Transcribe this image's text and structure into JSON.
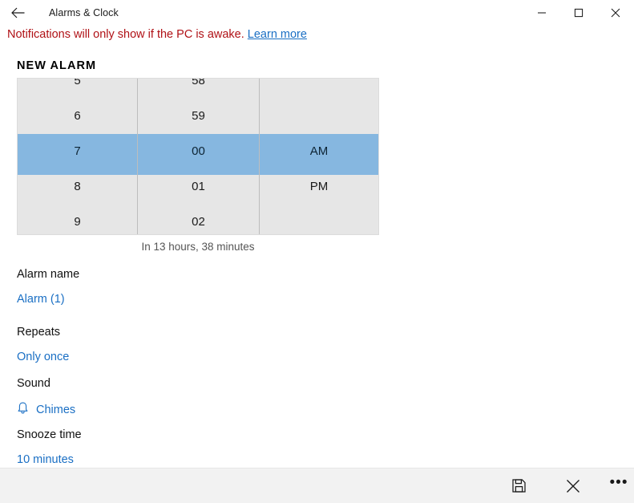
{
  "window": {
    "title": "Alarms & Clock",
    "back_icon": "back-arrow-icon",
    "minimize_label": "Minimize",
    "maximize_label": "Maximize",
    "close_label": "Close"
  },
  "notice": {
    "text": "Notifications will only show if the PC is awake.",
    "link_text": "Learn more",
    "text_color": "#b01116",
    "link_color": "#1a6fc4"
  },
  "section": {
    "title": "NEW ALARM"
  },
  "time_picker": {
    "selected_hour": "7",
    "selected_minute": "00",
    "selected_period": "AM",
    "highlight_color": "#86b7e0",
    "background_color": "#e6e6e6",
    "hours": [
      "5",
      "6",
      "7",
      "8",
      "9"
    ],
    "minutes": [
      "58",
      "59",
      "00",
      "01",
      "02"
    ],
    "periods": [
      "",
      "",
      "AM",
      "PM",
      ""
    ],
    "hint": "In 13 hours, 38 minutes"
  },
  "fields": {
    "alarm_name": {
      "label": "Alarm name",
      "value": "Alarm (1)"
    },
    "repeats": {
      "label": "Repeats",
      "value": "Only once"
    },
    "sound": {
      "label": "Sound",
      "value": "Chimes",
      "icon": "bell-icon"
    },
    "snooze_time": {
      "label": "Snooze time",
      "value": "10 minutes"
    }
  },
  "command_bar": {
    "save_label": "Save",
    "save_icon": "save-floppy-icon",
    "cancel_label": "Cancel",
    "cancel_icon": "close-x-icon",
    "more_label": "See more",
    "more_icon": "ellipsis-icon",
    "more_glyph": "•••"
  }
}
